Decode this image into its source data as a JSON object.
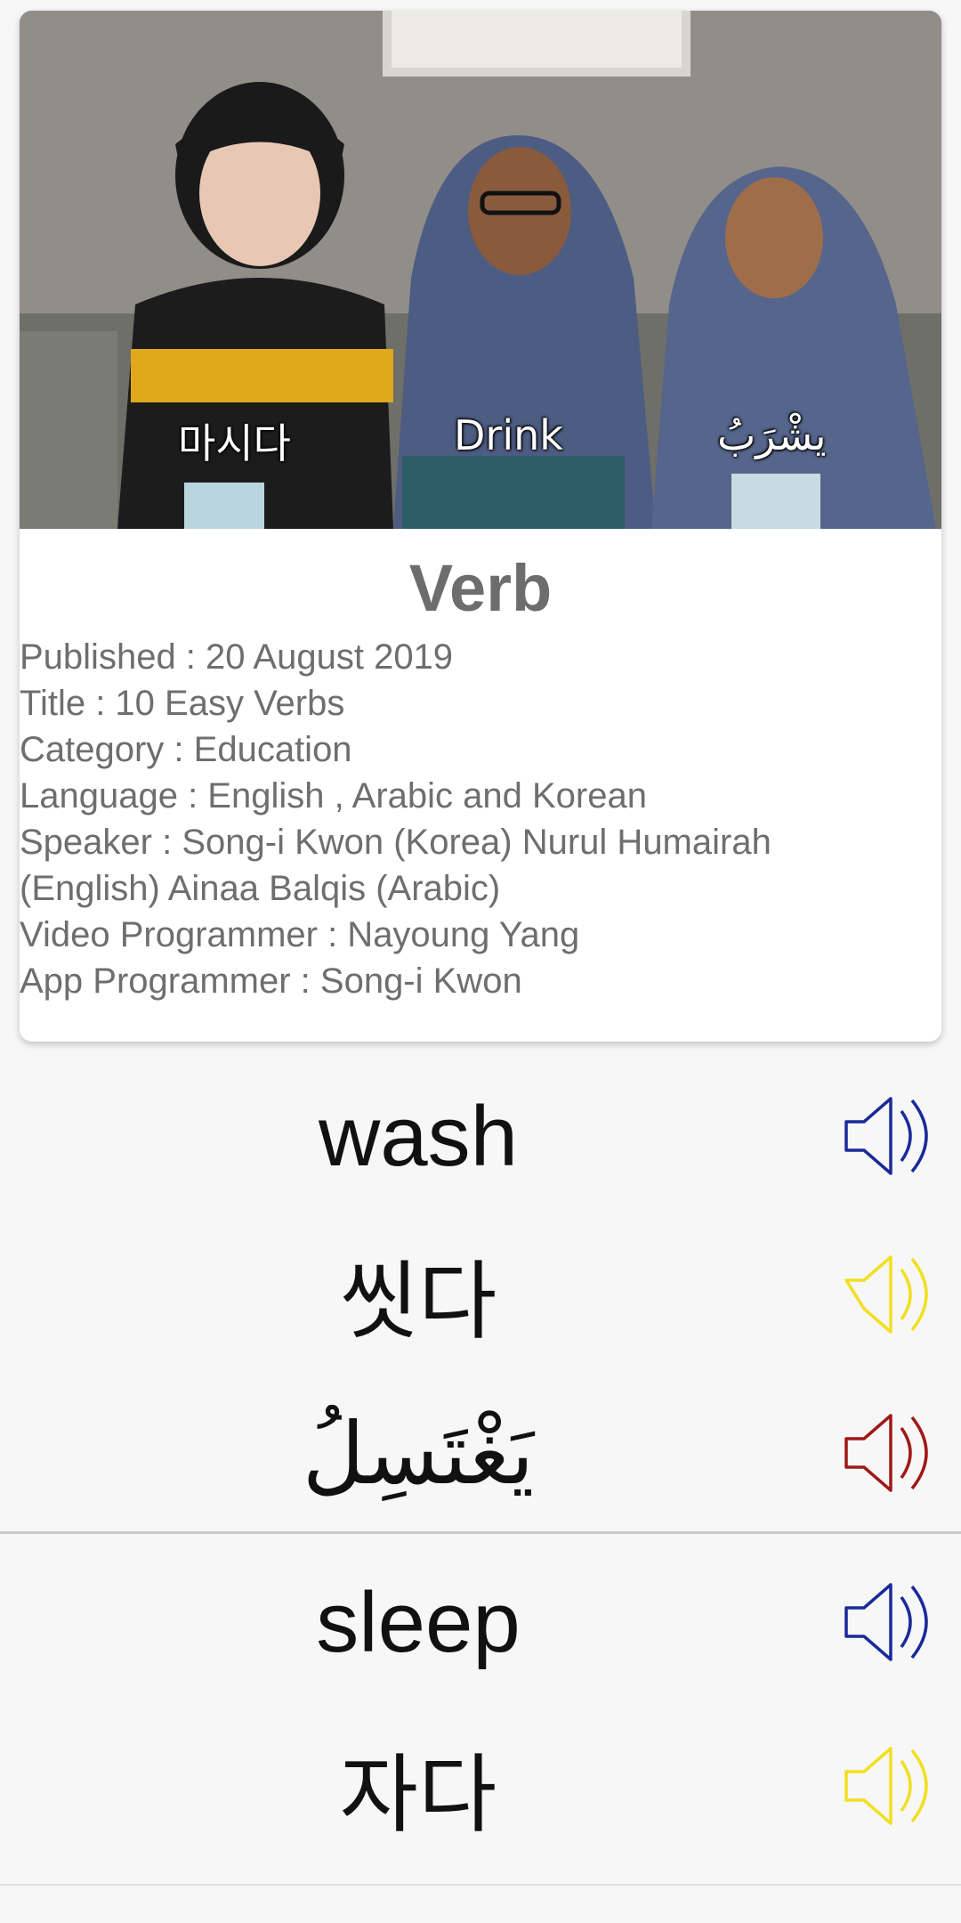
{
  "card": {
    "captions": [
      "마시다",
      "Drink",
      "يشْرَبُ"
    ],
    "title": "Verb",
    "info": [
      "Published : 20 August 2019",
      " Title : 10 Easy Verbs",
      " Category : Education",
      " Language : English , Arabic and Korean",
      " Speaker : Song-i Kwon (Korea) Nurul Humairah",
      "(English) Ainaa Balqis (Arabic)",
      " Video Programmer : Nayoung Yang",
      " App Programmer : Song-i Kwon"
    ]
  },
  "words": [
    {
      "text": "wash",
      "speaker_icon": "speaker-icon",
      "color": "#1a2a9a"
    },
    {
      "text": "씻다",
      "speaker_icon": "speaker-icon",
      "color": "#f0e020"
    },
    {
      "text": "يَغْتَسِلُ",
      "speaker_icon": "speaker-icon",
      "color": "#a01818"
    },
    {
      "text": "sleep",
      "speaker_icon": "speaker-icon",
      "color": "#1a2a9a"
    },
    {
      "text": "자다",
      "speaker_icon": "speaker-icon",
      "color": "#f0e020"
    }
  ]
}
